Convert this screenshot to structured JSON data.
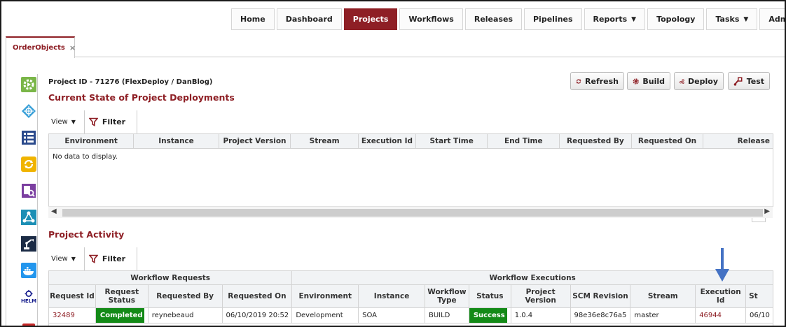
{
  "nav": {
    "items": [
      {
        "label": "Home",
        "active": false,
        "dropdown": false
      },
      {
        "label": "Dashboard",
        "active": false,
        "dropdown": false
      },
      {
        "label": "Projects",
        "active": true,
        "dropdown": false
      },
      {
        "label": "Workflows",
        "active": false,
        "dropdown": false
      },
      {
        "label": "Releases",
        "active": false,
        "dropdown": false
      },
      {
        "label": "Pipelines",
        "active": false,
        "dropdown": false
      },
      {
        "label": "Reports",
        "active": false,
        "dropdown": true
      },
      {
        "label": "Topology",
        "active": false,
        "dropdown": false
      },
      {
        "label": "Tasks",
        "active": false,
        "dropdown": true
      },
      {
        "label": "Administration",
        "active": false,
        "dropdown": true
      }
    ],
    "accent_color": "#8e1f25"
  },
  "tab": {
    "label": "OrderObjects",
    "close": "×"
  },
  "sidebar_icons": [
    "workflow-gear-icon",
    "network-icon",
    "checklist-icon",
    "sync-icon",
    "report-search-icon",
    "topology-icon",
    "robot-arm-icon",
    "docker-icon",
    "helm-icon"
  ],
  "sidebar_helm_text": "HELM",
  "project": {
    "title": "Project ID - 71276 (FlexDeploy / DanBlog)"
  },
  "actions": {
    "refresh": "Refresh",
    "build": "Build",
    "deploy": "Deploy",
    "test": "Test"
  },
  "deployments": {
    "title": "Current State of Project Deployments",
    "view_label": "View",
    "filter_label": "Filter",
    "columns": [
      "Environment",
      "Instance",
      "Project Version",
      "Stream",
      "Execution Id",
      "Start Time",
      "End Time",
      "Requested By",
      "Requested On",
      "Release"
    ],
    "empty_text": "No data to display."
  },
  "activity": {
    "title": "Project Activity",
    "view_label": "View",
    "filter_label": "Filter",
    "group_requests": "Workflow Requests",
    "group_executions": "Workflow Executions",
    "columns": [
      "Request Id",
      "Request Status",
      "Requested By",
      "Requested On",
      "Environment",
      "Instance",
      "Workflow Type",
      "Status",
      "Project Version",
      "SCM Revision",
      "Stream",
      "Execution Id",
      "St"
    ],
    "rows": [
      {
        "request_id": "32489",
        "request_status": "Completed",
        "requested_by": "reynebeaud",
        "requested_on": "06/10/2019 20:52",
        "environment": "Development",
        "instance": "SOA",
        "workflow_type": "BUILD",
        "status": "Success",
        "project_version": "1.0.4",
        "scm_revision": "98e36e8c76a5",
        "stream": "master",
        "execution_id": "46944",
        "start": "06/10"
      }
    ]
  },
  "colors": {
    "success": "#138a17",
    "annotation_arrow": "#4472c4"
  }
}
